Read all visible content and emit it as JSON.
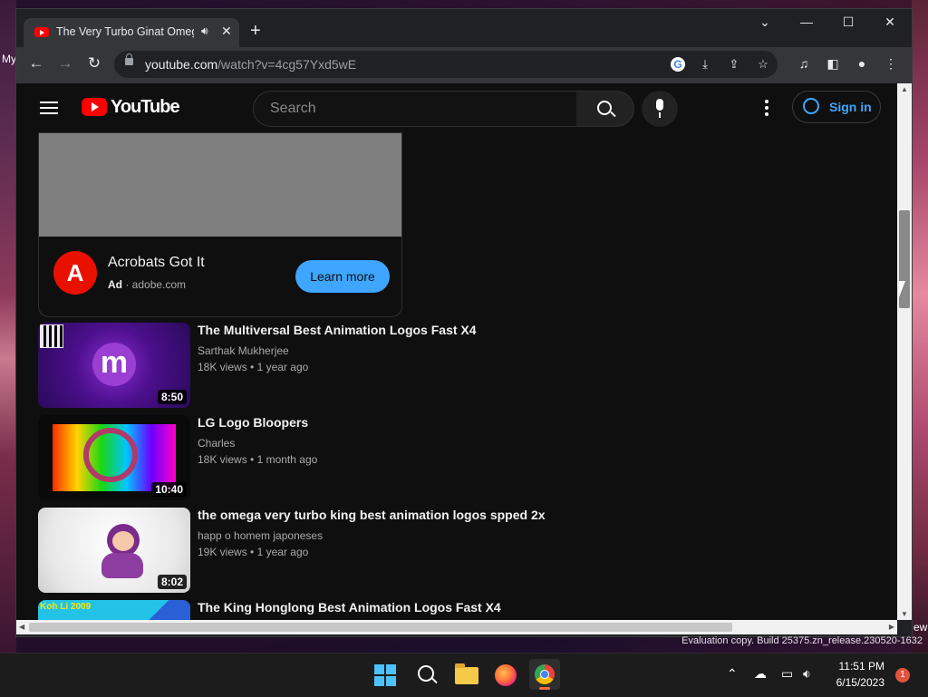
{
  "browser": {
    "tab_title": "The Very Turbo Ginat Omega Very Turbo King Best Animation Logos",
    "new_tab_label": "+",
    "url_host": "youtube.com",
    "url_path": "/watch?v=4cg57Yxd5wE"
  },
  "youtube": {
    "logo_text": "YouTube",
    "search_placeholder": "Search",
    "sign_in": "Sign in"
  },
  "ad": {
    "logo_glyph": "A",
    "title": "Acrobats Got It",
    "ad_label": "Ad",
    "domain": "adobe.com",
    "cta": "Learn more"
  },
  "videos": [
    {
      "title": "The Multiversal Best Animation Logos Fast X4",
      "channel": "Sarthak Mukherjee",
      "views": "18K views",
      "age": "1 year ago",
      "duration": "8:50",
      "thumb_glyph": "m"
    },
    {
      "title": "LG Logo Bloopers",
      "channel": "Charles",
      "views": "18K views",
      "age": "1 month ago",
      "duration": "10:40"
    },
    {
      "title": "the omega very turbo king best animation logos spped 2x",
      "channel": "happ o homem japoneses",
      "views": "19K views",
      "age": "1 year ago",
      "duration": "8:02"
    },
    {
      "title": "The King Honglong Best Animation Logos Fast X4",
      "thumb_text": "Koh Li 2009"
    }
  ],
  "desktop": {
    "label_my": "My",
    "label_ew": "ew",
    "watermark": "Evaluation copy. Build 25375.zn_release.230520-1632"
  },
  "taskbar": {
    "time": "11:51 PM",
    "date": "6/15/2023",
    "notifications": "1"
  }
}
